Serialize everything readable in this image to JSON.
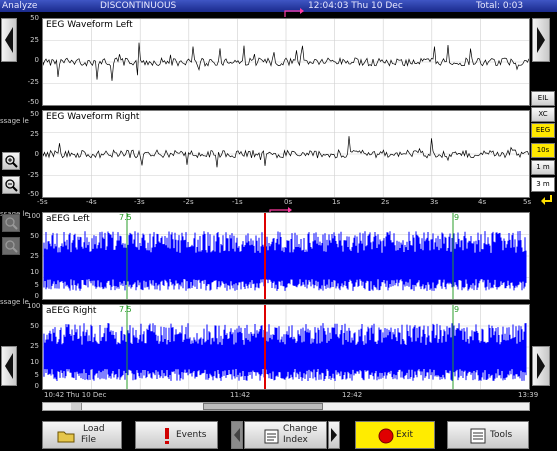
{
  "topbar": {
    "app": "Analyze",
    "mode": "DISCONTINUOUS",
    "clock": "12:04:03 Thu 10 Dec",
    "total": "Total: 0:03"
  },
  "eeg": {
    "left_title": "EEG Waveform Left",
    "right_title": "EEG Waveform Right",
    "y_ticks_top": [
      "50",
      "25",
      "0",
      "-25",
      "-50"
    ],
    "y_ticks_bottom": [
      "50",
      "25",
      "0",
      "-25",
      "-50"
    ],
    "side_caption": "ssage le",
    "x_ticks": [
      "-5s",
      "-4s",
      "-3s",
      "-2s",
      "-1s",
      "0s",
      "1s",
      "2s",
      "3s",
      "4s",
      "5s"
    ]
  },
  "aeeg": {
    "left_title": "aEEG Left",
    "right_title": "aEEG Right",
    "y_ticks": [
      "100",
      "50",
      "25",
      "10",
      "5",
      "0"
    ],
    "marker_left": "7.5",
    "marker_right": "9",
    "time_start": "10:42 Thu 10 Dec",
    "time_mid": "11:42",
    "time_mid2": "12:42",
    "time_end": "13:39"
  },
  "right_buttons": [
    "EIL",
    "XC",
    "EEG",
    "10s",
    "1 m",
    "3 m"
  ],
  "toolbar": {
    "file_top": "Load",
    "file_bottom": "File",
    "events": "Events",
    "change_top": "Change",
    "change_bottom": "Index",
    "exit": "Exit",
    "tools": "Tools"
  },
  "colors": {
    "topbar": "#2a3ca8",
    "aeeg_trace": "#0000ff",
    "cursor": "#dd0000",
    "exit_button": "#ffec00",
    "marker": "#2a9d2a"
  },
  "icons": [
    "left-arrow-icon",
    "right-arrow-icon",
    "zoom-in-icon",
    "zoom-out-icon",
    "folder-icon",
    "alert-icon",
    "notes-icon",
    "stop-icon",
    "list-icon"
  ]
}
